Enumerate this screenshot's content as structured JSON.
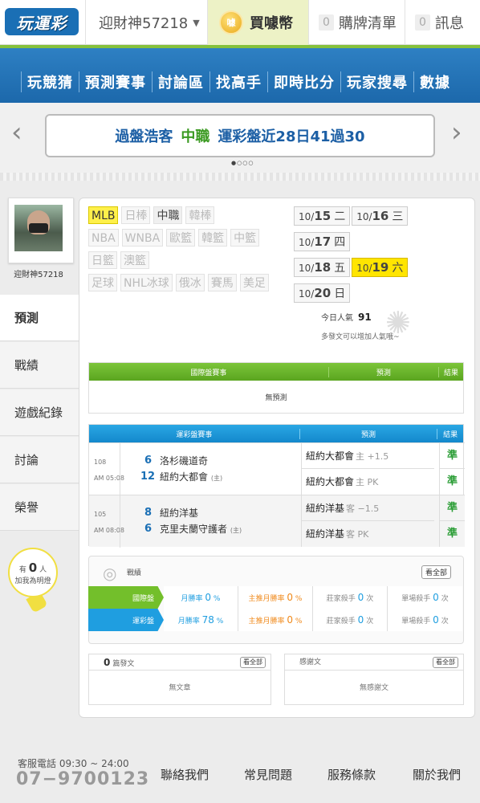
{
  "topbar": {
    "logo": "玩運彩",
    "user": "迎財神57218",
    "buy_label": "買噱幣",
    "coin_text": "噱",
    "list_count": "0",
    "list_label": "購牌清單",
    "msg_count": "0",
    "msg_label": "訊息"
  },
  "nav": [
    "玩競猜",
    "預測賽事",
    "討論區",
    "找高手",
    "即時比分",
    "玩家搜尋",
    "數據"
  ],
  "banner": {
    "text1": "過盤浩客",
    "text2": "中職",
    "text3": "運彩盤近28日41過30"
  },
  "profile": {
    "name": "迎財神57218"
  },
  "sidenav": [
    "預測",
    "戰績",
    "遊戲紀錄",
    "討論",
    "榮譽"
  ],
  "bulb": {
    "prefix": "有",
    "count": "0",
    "suffix": "人",
    "caption": "加我為明燈"
  },
  "league_tags": [
    {
      "label": "MLB",
      "state": "on"
    },
    {
      "label": "日棒",
      "state": "off"
    },
    {
      "label": "中職",
      "state": "mid"
    },
    {
      "label": "韓棒",
      "state": "off"
    },
    {
      "label": "NBA",
      "state": "off"
    },
    {
      "label": "WNBA",
      "state": "off"
    },
    {
      "label": "歐籃",
      "state": "off"
    },
    {
      "label": "韓籃",
      "state": "off"
    },
    {
      "label": "中籃",
      "state": "off"
    },
    {
      "label": "日籃",
      "state": "off"
    },
    {
      "label": "澳籃",
      "state": "off"
    },
    {
      "label": "足球",
      "state": "off"
    },
    {
      "label": "NHL冰球",
      "state": "off"
    },
    {
      "label": "俄冰",
      "state": "off"
    },
    {
      "label": "賽馬",
      "state": "off"
    },
    {
      "label": "美足",
      "state": "off"
    }
  ],
  "dates": [
    {
      "md": "10/",
      "day": "15",
      "wd": "二",
      "on": false
    },
    {
      "md": "10/",
      "day": "16",
      "wd": "三",
      "on": false
    },
    {
      "md": "10/",
      "day": "17",
      "wd": "四",
      "on": false
    },
    {
      "md": "10/",
      "day": "18",
      "wd": "五",
      "on": false
    },
    {
      "md": "10/",
      "day": "19",
      "wd": "六",
      "on": true
    },
    {
      "md": "10/",
      "day": "20",
      "wd": "日",
      "on": false
    }
  ],
  "popularity": {
    "label": "今日人氣",
    "value": "91",
    "tip": "多發文可以增加人氣哦~"
  },
  "intl_table": {
    "col1": "國際盤賽事",
    "col2": "預測",
    "col3": "結果",
    "empty": "無預測"
  },
  "sport_table": {
    "col1": "運彩盤賽事",
    "col2": "預測",
    "col3": "結果",
    "rows": [
      {
        "num": "108",
        "time": "AM 05:08",
        "away_score": "6",
        "away": "洛杉磯道奇",
        "home_score": "12",
        "home": "紐約大都會",
        "home_tag": "(主)",
        "preds": [
          {
            "team": "紐約大都會",
            "side": "主 +1.5",
            "result": "準"
          },
          {
            "team": "紐約大都會",
            "side": "主 PK",
            "result": "準"
          }
        ]
      },
      {
        "num": "105",
        "time": "AM 08:08",
        "away_score": "8",
        "away": "紐約洋基",
        "home_score": "6",
        "home": "克里夫蘭守護者",
        "home_tag": "(主)",
        "preds": [
          {
            "team": "紐約洋基",
            "side": "客 −1.5",
            "result": "準"
          },
          {
            "team": "紐約洋基",
            "side": "客 PK",
            "result": "準"
          }
        ]
      }
    ]
  },
  "record": {
    "title": "戰績",
    "all_btn": "看全部",
    "rows": [
      {
        "label": "國際盤",
        "color": "#73bf2b",
        "month_label": "月勝率",
        "month": "0",
        "pct": "%",
        "main_label": "主推月勝率",
        "main": "0",
        "dealer_label": "莊家殺手",
        "dealer": "0",
        "dealer_unit": "次",
        "single_label": "單場殺手",
        "single": "0",
        "single_unit": "次"
      },
      {
        "label": "運彩盤",
        "color": "#1f9ee0",
        "month_label": "月勝率",
        "month": "78",
        "pct": "%",
        "main_label": "主推月勝率",
        "main": "0",
        "dealer_label": "莊家殺手",
        "dealer": "0",
        "dealer_unit": "次",
        "single_label": "單場殺手",
        "single": "0",
        "single_unit": "次"
      }
    ]
  },
  "posts": {
    "count": "0",
    "label": "篇發文",
    "btn": "看全部",
    "empty": "無文章"
  },
  "thanks": {
    "label": "感謝文",
    "btn": "看全部",
    "empty": "無感謝文"
  },
  "footer": {
    "tel_label": "客服電話 09:30 ~ 24:00",
    "tel": "07−9700123",
    "links": [
      "聯絡我們",
      "常見問題",
      "服務條款",
      "關於我們"
    ]
  },
  "colors": {
    "nav": "#1f6aae",
    "accent_green": "#86c13c",
    "yellow": "#ffe500"
  }
}
